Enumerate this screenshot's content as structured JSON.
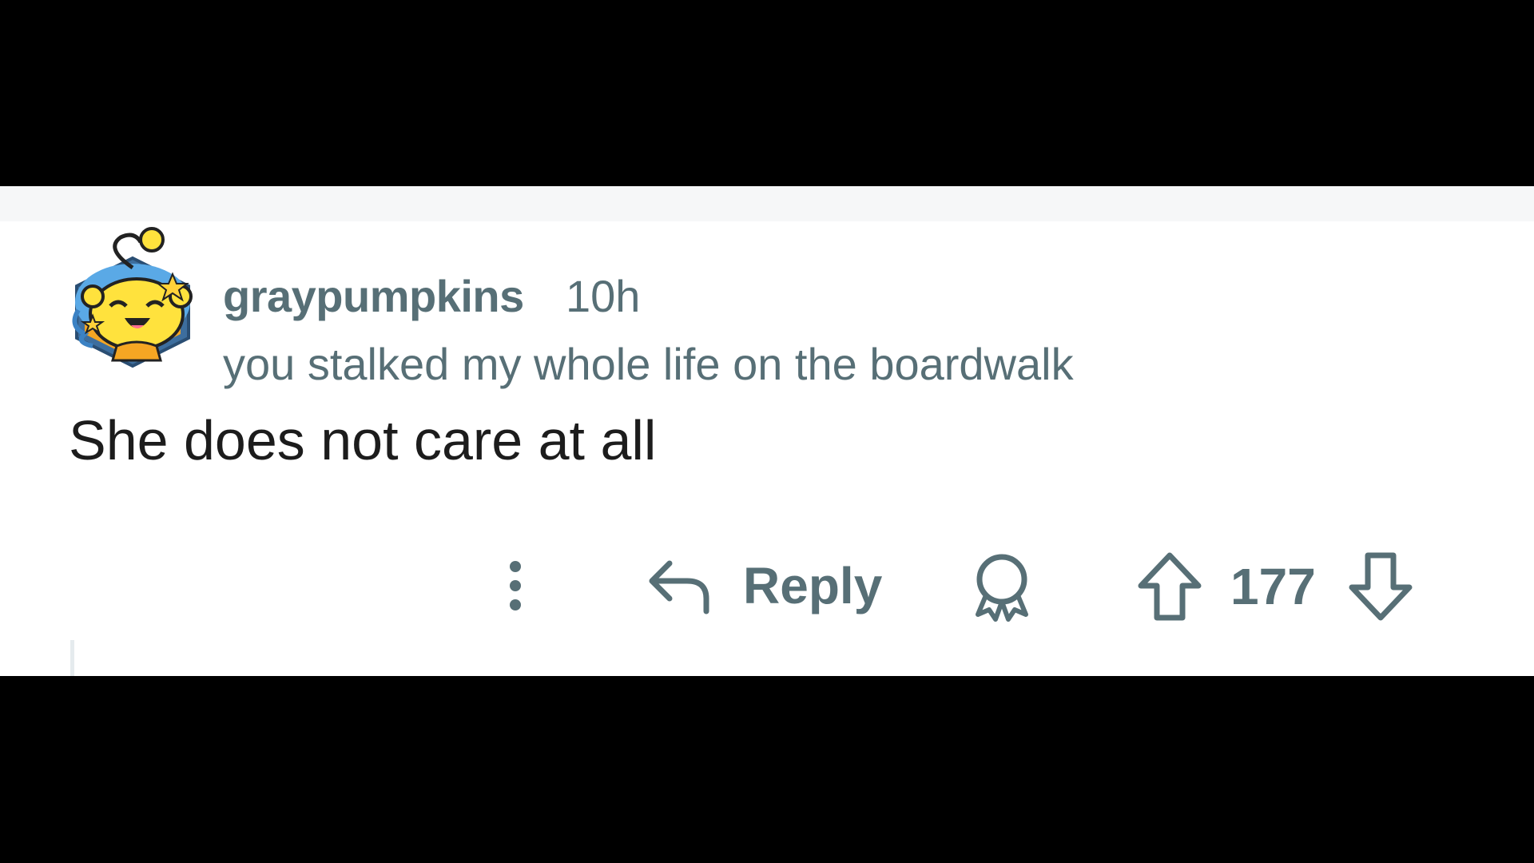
{
  "comment": {
    "author": "graypumpkins",
    "age": "10h",
    "flair": "you stalked my whole life on the boardwalk",
    "body": "She does not care at all"
  },
  "actions": {
    "more_icon": "more-vertical-icon",
    "reply_icon": "reply-arrow-icon",
    "reply_label": "Reply",
    "award_icon": "award-icon",
    "upvote_icon": "upvote-arrow-icon",
    "score": "177",
    "downvote_icon": "downvote-arrow-icon"
  },
  "colors": {
    "meta_text": "#576f76",
    "body_text": "#1c1c1c",
    "panel_background": "#ffffff",
    "letterbox": "#000000"
  }
}
